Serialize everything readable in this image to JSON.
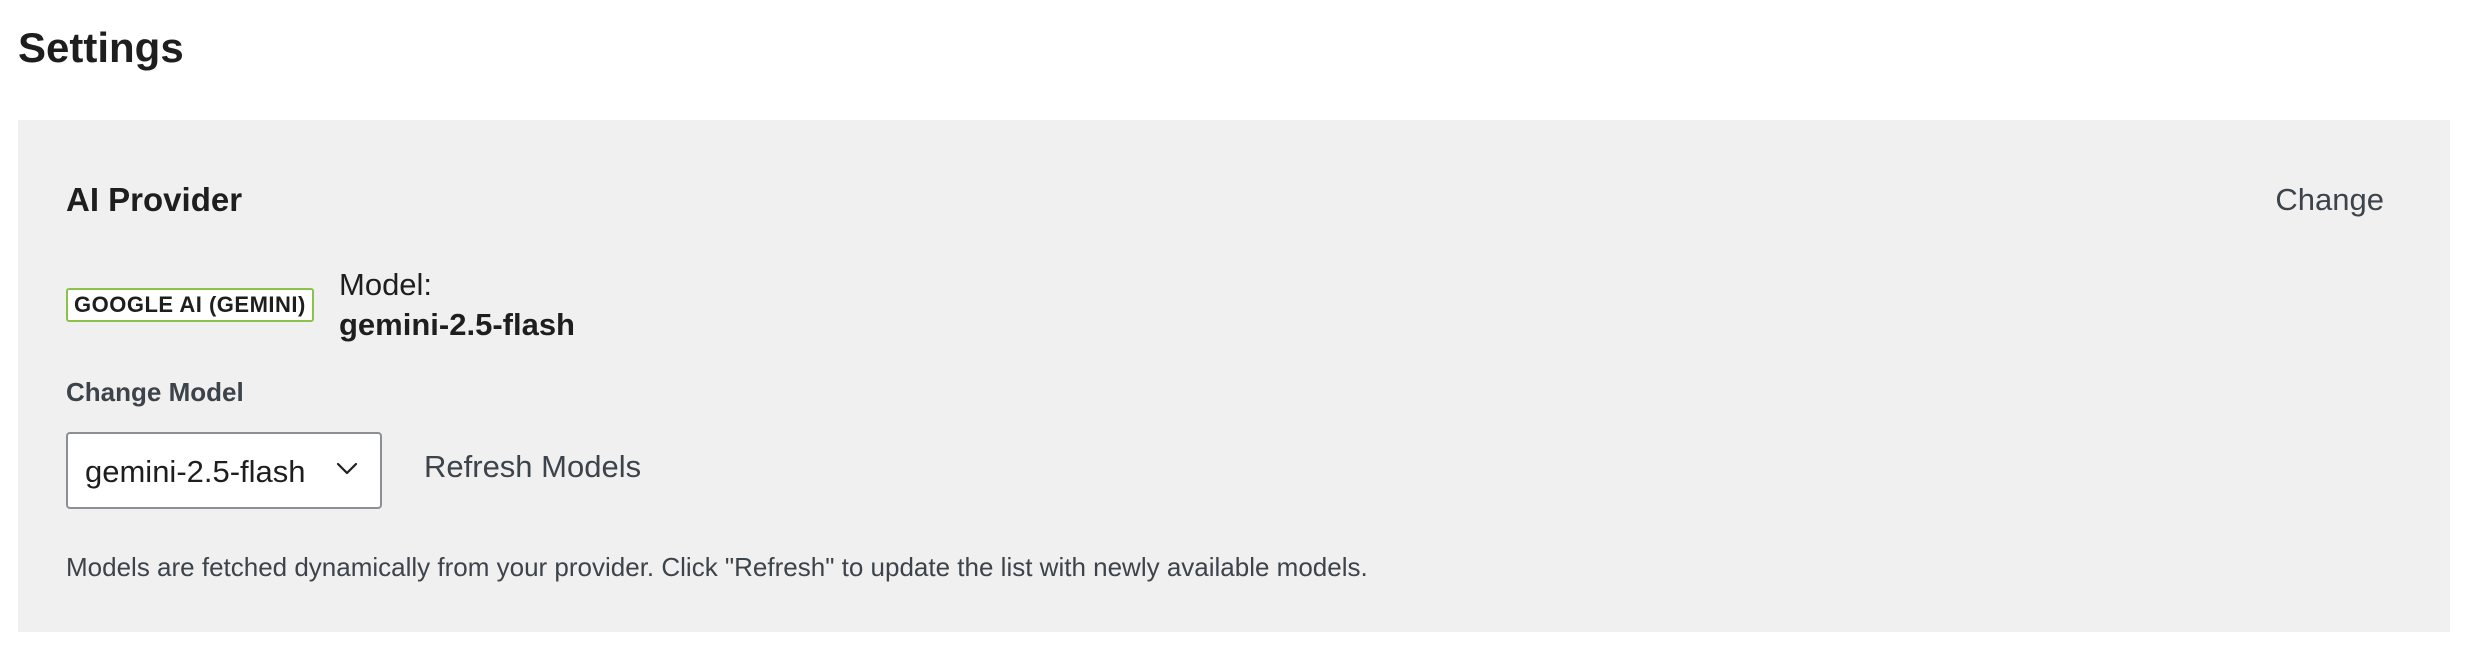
{
  "page": {
    "title": "Settings"
  },
  "ai_provider": {
    "section_title": "AI Provider",
    "change_label": "Change",
    "provider_badge": "GOOGLE AI (GEMINI)",
    "model_label": "Model:",
    "model_value": "gemini-2.5-flash",
    "change_model_label": "Change Model",
    "select": {
      "selected_value": "gemini-2.5-flash"
    },
    "refresh_label": "Refresh Models",
    "help_text": "Models are fetched dynamically from your provider. Click \"Refresh\" to update the list with newly available models."
  },
  "colors": {
    "panel_background": "#f0f0f0",
    "badge_border": "#8bc34a",
    "text_primary": "#1e1e1e",
    "text_secondary": "#3c434a"
  },
  "icons": {
    "select_indicator": "chevron-down-icon"
  }
}
